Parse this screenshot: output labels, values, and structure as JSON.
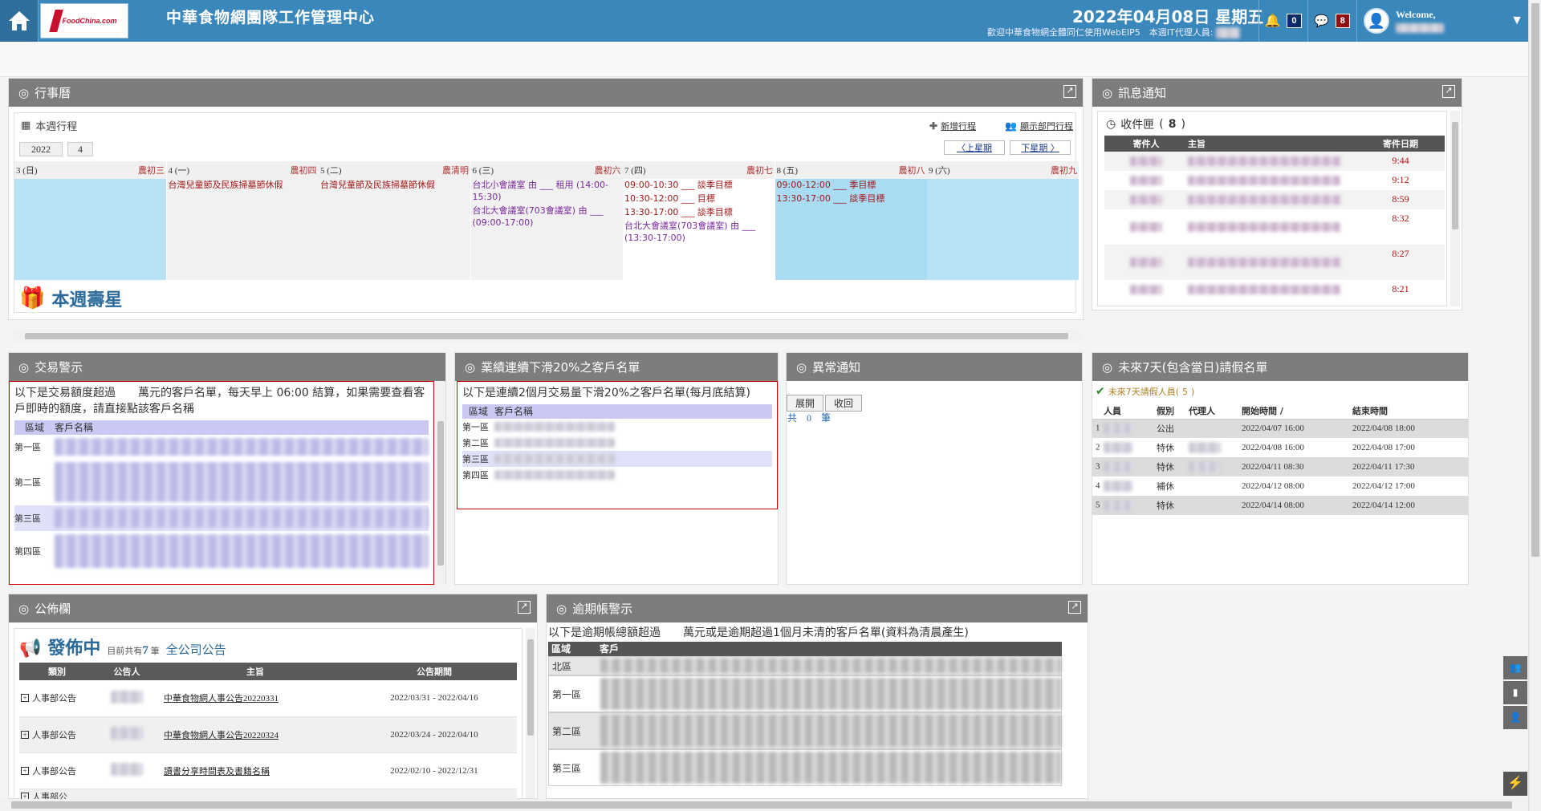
{
  "header": {
    "title": "中華食物網團隊工作管理中心",
    "logo_text": "FoodChina.com",
    "date": "2022年04月08日 星期五",
    "subtitle": "歡迎中華食物網全體同仁使用WebEIP5　本週IT代理人員:",
    "notify_count": "0",
    "message_count": "8",
    "welcome": "Welcome,"
  },
  "calendar": {
    "title": "行事曆",
    "subtitle": "本週行程",
    "year": "2022",
    "month": "4",
    "add_link": "新增行程",
    "dept_link": "顯示部門行程",
    "prev_week": "〈上星期",
    "next_week": "下星期 〉",
    "days": [
      {
        "day": "3 (日)",
        "lunar": "農初三",
        "color": "#b8e2f5",
        "events": []
      },
      {
        "day": "4 (一)",
        "lunar": "農初四",
        "color": "#f1f1f1",
        "events": [
          {
            "text": "台灣兒童節及民族掃墓節休假",
            "cls": ""
          }
        ]
      },
      {
        "day": "5 (二)",
        "lunar": "農清明",
        "color": "#f1f1f1",
        "events": [
          {
            "text": "台灣兒童節及民族掃墓節休假",
            "cls": ""
          }
        ]
      },
      {
        "day": "6 (三)",
        "lunar": "農初六",
        "color": "#f1f1f1",
        "events": [
          {
            "text": "台北小會議室 由 ___ 租用 (14:00-15:30)",
            "cls": "p"
          },
          {
            "text": "台北大會議室(703會議室) 由 ___ (09:00-17:00)",
            "cls": "p"
          }
        ]
      },
      {
        "day": "7 (四)",
        "lunar": "農初七",
        "color": "#ffffff",
        "events": [
          {
            "text": "09:00-10:30 ___ 談季目標",
            "cls": ""
          },
          {
            "text": "10:30-12:00 ___ 目標",
            "cls": ""
          },
          {
            "text": "13:30-17:00 ___ 談季目標",
            "cls": ""
          },
          {
            "text": "台北大會議室(703會議室) 由 ___ (13:30-17:00)",
            "cls": "p"
          }
        ]
      },
      {
        "day": "8 (五)",
        "lunar": "農初八",
        "color": "#a9dbf3",
        "events": [
          {
            "text": "09:00-12:00 ___ 季目標",
            "cls": ""
          },
          {
            "text": "13:30-17:00 ___ 談季目標",
            "cls": ""
          }
        ]
      },
      {
        "day": "9 (六)",
        "lunar": "農初九",
        "color": "#b8e2f5",
        "events": []
      }
    ],
    "birthday_title": "本週壽星"
  },
  "inbox": {
    "title": "訊息通知",
    "label": "收件匣",
    "count": "8",
    "cols": [
      "寄件人",
      "主旨",
      "寄件日期"
    ],
    "times": [
      "9:44",
      "9:12",
      "8:59",
      "8:32",
      "8:27",
      "8:21"
    ]
  },
  "trade": {
    "title": "交易警示",
    "desc": "以下是交易額度超過　　萬元的客戶名單，每天早上 06:00 結算，如果需要查看客戶即時的額度，請直接點該客戶名稱",
    "cols": [
      "區域",
      "客戶名稱"
    ],
    "regions": [
      "第一區",
      "第二區",
      "第三區",
      "第四區"
    ]
  },
  "decline": {
    "title": "業績連續下滑20%之客戶名單",
    "desc": "以下是連續2個月交易量下滑20%之客戶名單(每月底結算)",
    "cols": [
      "區域",
      "客戶名稱"
    ],
    "regions": [
      "第一區",
      "第二區",
      "第三區",
      "第四區"
    ]
  },
  "abnormal": {
    "title": "異常通知",
    "expand": "展開",
    "collapse": "收回",
    "total": "共　0　筆"
  },
  "leave": {
    "title": "未來7天(包含當日)請假名單",
    "count_label": "未來7天請假人員(",
    "count": "5",
    "count_end": ")",
    "cols": [
      "人員",
      "假別",
      "代理人",
      "開始時間 /",
      "結束時間"
    ],
    "rows": [
      {
        "no": "1",
        "type": "公出",
        "start": "2022/04/07 16:00",
        "end": "2022/04/08 18:00"
      },
      {
        "no": "2",
        "type": "特休",
        "start": "2022/04/08 16:00",
        "end": "2022/04/08 17:00"
      },
      {
        "no": "3",
        "type": "特休",
        "start": "2022/04/11 08:30",
        "end": "2022/04/11 17:30"
      },
      {
        "no": "4",
        "type": "補休",
        "start": "2022/04/12 08:00",
        "end": "2022/04/12 17:00"
      },
      {
        "no": "5",
        "type": "特休",
        "start": "2022/04/14 08:00",
        "end": "2022/04/14 12:00"
      }
    ]
  },
  "bulletin": {
    "title": "公佈欄",
    "publishing": "發佈中",
    "count_prefix": "目前共有",
    "count": "7",
    "count_suffix": "筆",
    "all_link": "全公司公告",
    "cols": [
      "類別",
      "公告人",
      "主旨",
      "公告期間"
    ],
    "rows": [
      {
        "category": "人事部公告",
        "subject": "中華食物網人事公告20220331",
        "period": "2022/03/31 - 2022/04/16"
      },
      {
        "category": "人事部公告",
        "subject": "中華食物網人事公告20220324",
        "period": "2022/03/24 - 2022/04/10"
      },
      {
        "category": "人事部公告",
        "subject": "讀書分享時間表及書籍名稱",
        "period": "2022/02/10 - 2022/12/31"
      },
      {
        "category": "人事部公",
        "subject": "",
        "period": ""
      }
    ]
  },
  "overdue": {
    "title": "逾期帳警示",
    "desc": "以下是逾期帳總額超過　　萬元或是逾期超過1個月未清的客戶名單(資料為清晨產生)",
    "cols": [
      "區域",
      "客戶"
    ],
    "regions": [
      "北區",
      "第一區",
      "第二區",
      "第三區"
    ]
  },
  "icons": {
    "home": "home-icon",
    "bell": "bell-icon",
    "chat": "chat-icon",
    "user": "user-icon",
    "dashboard": "dashboard-icon"
  }
}
